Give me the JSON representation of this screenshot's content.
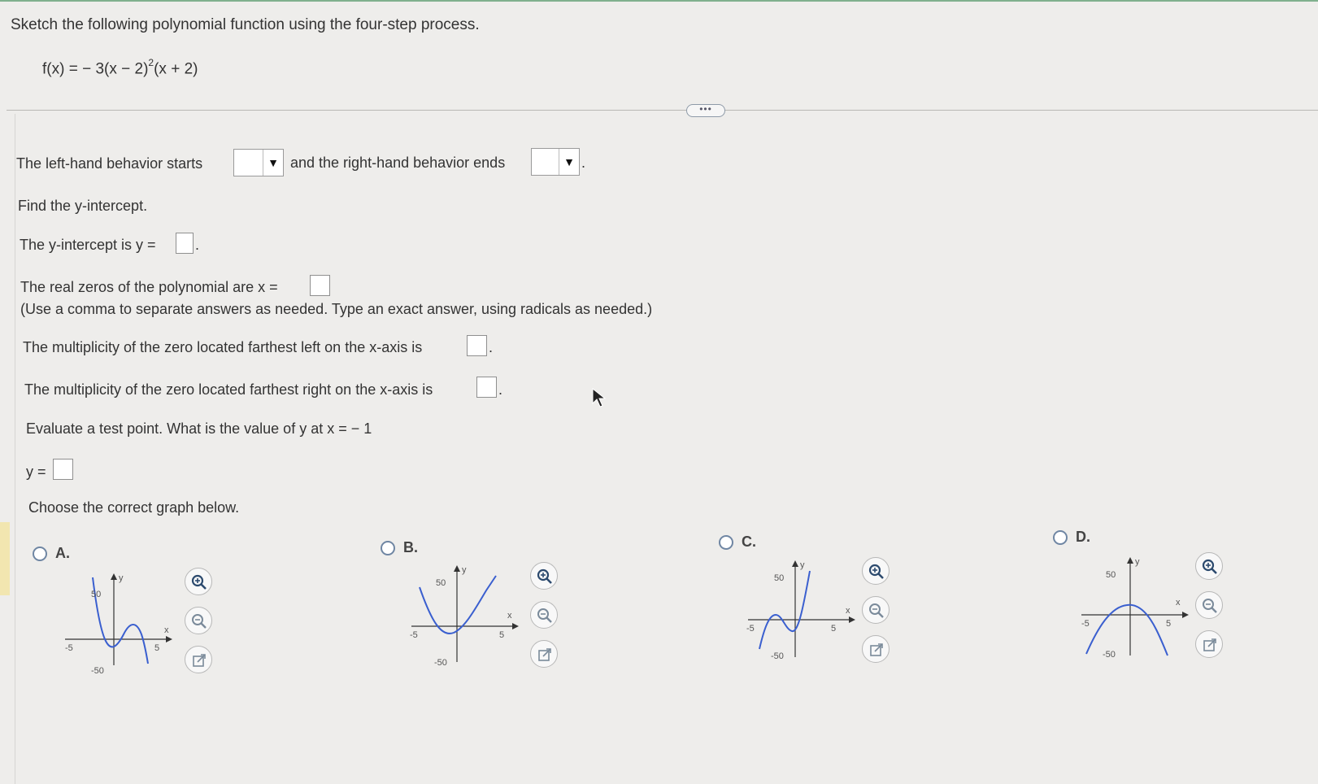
{
  "question": {
    "instruction": "Sketch the following polynomial function using the four-step process.",
    "function_lhs": "f(x) = − 3(x − 2)",
    "function_exp": "2",
    "function_rest": "(x + 2)"
  },
  "toolbar": {
    "more_label": "•••"
  },
  "steps": {
    "behavior_prefix": "The left-hand behavior starts",
    "behavior_middle": "and the right-hand behavior ends",
    "behavior_suffix": ".",
    "find_y_intercept": "Find the y-intercept.",
    "y_intercept_label": "The y-intercept is y =",
    "y_intercept_suffix": ".",
    "zeros_label": "The real zeros of the polynomial are x =",
    "zeros_hint": "(Use a comma to separate answers as needed. Type an exact answer, using radicals as needed.)",
    "mult_left_label": "The multiplicity of the zero located farthest left on the x-axis is",
    "mult_left_suffix": ".",
    "mult_right_label": "The multiplicity of the zero located farthest right on the x-axis is",
    "mult_right_suffix": ".",
    "test_point_label": "Evaluate a test point. What is the value of y at x = − 1",
    "y_equals": "y =",
    "choose_graph": "Choose the correct graph below."
  },
  "options": [
    {
      "letter": "A.",
      "y_top": "50",
      "y_bottom": "-50",
      "x_left": "-5",
      "x_right": "5",
      "x_axis": "x",
      "y_axis": "y"
    },
    {
      "letter": "B.",
      "y_top": "50",
      "y_bottom": "-50",
      "x_left": "-5",
      "x_right": "5",
      "x_axis": "x",
      "y_axis": "y"
    },
    {
      "letter": "C.",
      "y_top": "50",
      "y_bottom": "-50",
      "x_left": "-5",
      "x_right": "5",
      "x_axis": "x",
      "y_axis": "y"
    },
    {
      "letter": "D.",
      "y_top": "50",
      "y_bottom": "-50",
      "x_left": "-5",
      "x_right": "5",
      "x_axis": "x",
      "y_axis": "y"
    }
  ],
  "colors": {
    "curve": "#3a5fcf",
    "radio_border": "#6f86a3",
    "top_accent": "#7fb08e"
  }
}
